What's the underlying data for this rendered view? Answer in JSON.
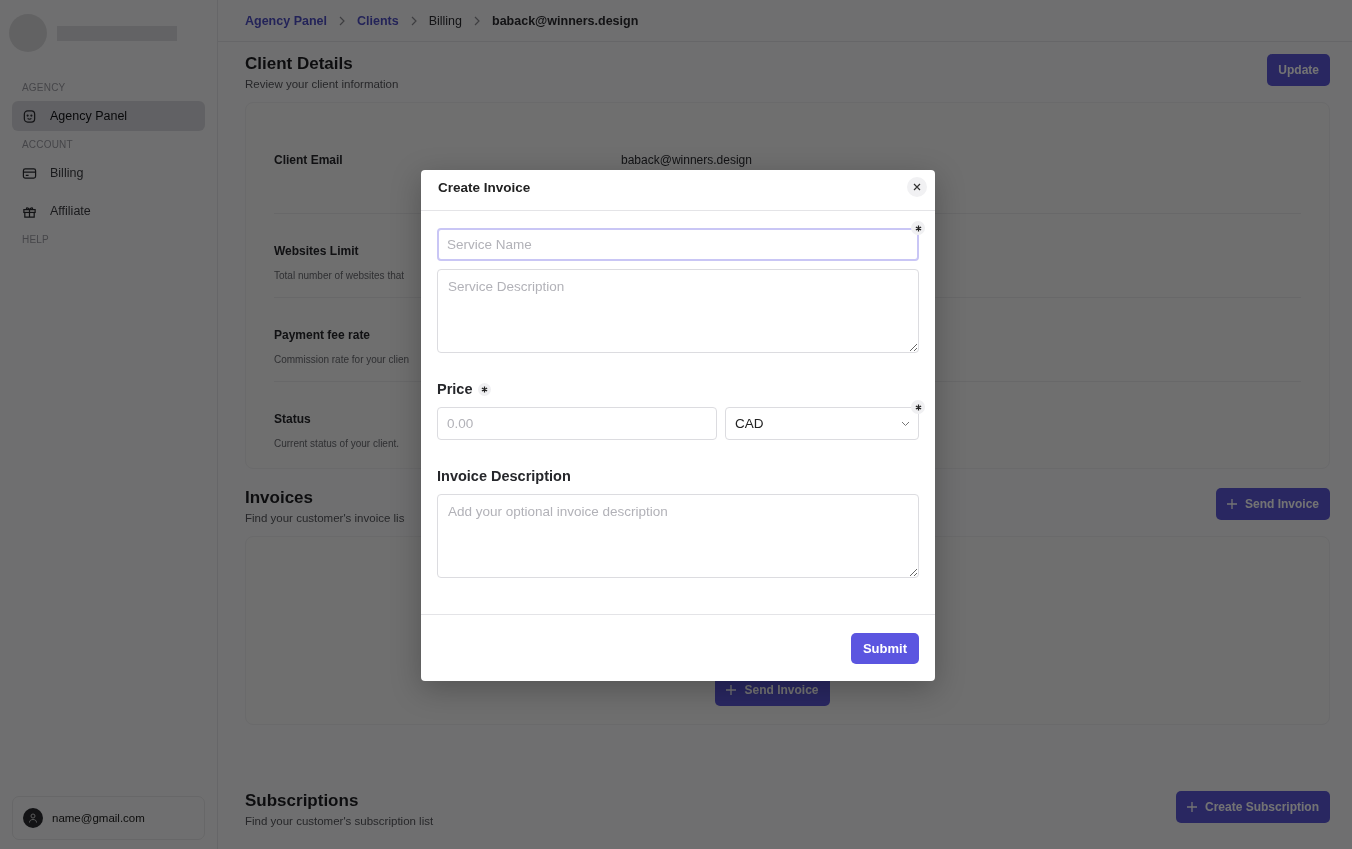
{
  "sidebar": {
    "sections": [
      {
        "title": "AGENCY",
        "items": [
          {
            "label": "Agency Panel",
            "selected": true
          }
        ]
      },
      {
        "title": "ACCOUNT",
        "items": [
          {
            "label": "Billing",
            "selected": false
          },
          {
            "label": "Affiliate",
            "selected": false
          }
        ]
      },
      {
        "title": "HELP"
      }
    ],
    "user": {
      "email": "name@gmail.com"
    }
  },
  "breadcrumb": [
    {
      "label": "Agency Panel",
      "kind": "link"
    },
    {
      "label": "Clients",
      "kind": "link"
    },
    {
      "label": "Billing",
      "kind": "plain"
    },
    {
      "label": "baback@winners.design",
      "kind": "current"
    }
  ],
  "client_details": {
    "title": "Client Details",
    "subtitle": "Review your client information",
    "button": "Update",
    "rows": [
      {
        "label": "Client Email",
        "value": "baback@winners.design"
      },
      {
        "label": "Websites Limit",
        "description": "Total number of websites that"
      },
      {
        "label": "Payment fee rate",
        "description": "Commission rate for your clien"
      },
      {
        "label": "Status",
        "description": "Current status of your client."
      }
    ]
  },
  "invoices": {
    "title": "Invoices",
    "subtitle": "Find your customer's invoice lis",
    "button": "Send Invoice",
    "empty_button": "Send Invoice"
  },
  "subscriptions": {
    "title": "Subscriptions",
    "subtitle": "Find your customer's subscription list",
    "button": "Create Subscription"
  },
  "modal": {
    "title": "Create Invoice",
    "service_name": {
      "placeholder": "Service Name",
      "required": true,
      "focused": true
    },
    "service_description": {
      "placeholder": "Service Description"
    },
    "price": {
      "label": "Price",
      "required": true,
      "placeholder": "0.00"
    },
    "currency": {
      "value": "CAD",
      "required": true
    },
    "invoice_description": {
      "label": "Invoice Description",
      "placeholder": "Add your optional invoice description"
    },
    "submit": "Submit"
  }
}
